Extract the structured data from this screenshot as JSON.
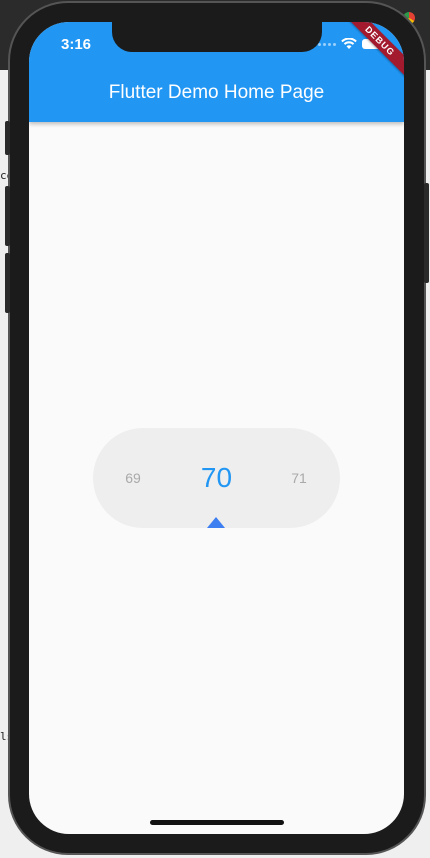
{
  "desktop": {
    "snippet_top": "ce",
    "snippet_bottom": "ls"
  },
  "status_bar": {
    "time": "3:16",
    "wifi_icon": "wifi-icon",
    "battery_icon": "battery-icon"
  },
  "debug_banner": "DEBUG",
  "app_bar": {
    "title": "Flutter Demo Home Page",
    "color": "#2196f3"
  },
  "number_picker": {
    "previous": "69",
    "current": "70",
    "next": "71",
    "accent_color": "#2196f3"
  }
}
